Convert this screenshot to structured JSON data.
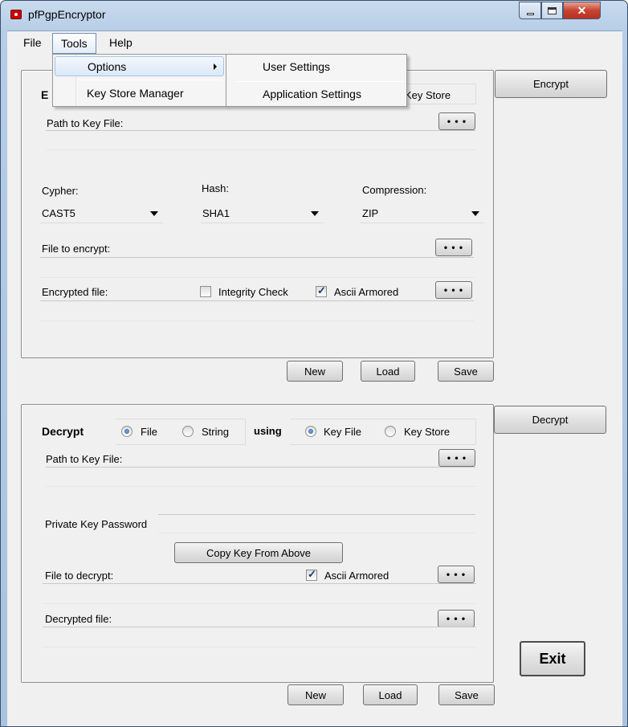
{
  "window": {
    "title": "pfPgpEncryptor"
  },
  "menu": {
    "file": "File",
    "tools": "Tools",
    "help": "Help"
  },
  "tools_menu": {
    "options": "Options",
    "key_store_manager": "Key Store Manager"
  },
  "options_submenu": {
    "user_settings": "User Settings",
    "application_settings": "Application Settings"
  },
  "encrypt": {
    "heading": "E",
    "key_store_label": "Key Store",
    "path_label": "Path to Key File:",
    "cypher_label": "Cypher:",
    "cypher_value": "CAST5",
    "hash_label": "Hash:",
    "hash_value": "SHA1",
    "compression_label": "Compression:",
    "compression_value": "ZIP",
    "file_label": "File to encrypt:",
    "output_label": "Encrypted file:",
    "integrity_label": "Integrity Check",
    "integrity_checked": false,
    "ascii_label": "Ascii Armored",
    "ascii_checked": true,
    "encrypt_button": "Encrypt",
    "new": "New",
    "load": "Load",
    "save": "Save"
  },
  "decrypt": {
    "heading": "Decrypt",
    "file_option": "File",
    "string_option": "String",
    "using": "using",
    "key_file_option": "Key File",
    "key_store_option": "Key Store",
    "path_label": "Path to Key File:",
    "password_label": "Private Key Password",
    "copy_key_button": "Copy Key From Above",
    "file_label": "File to decrypt:",
    "ascii_label": "Ascii Armored",
    "ascii_checked": true,
    "output_label": "Decrypted file:",
    "decrypt_button": "Decrypt",
    "new": "New",
    "load": "Load",
    "save": "Save"
  },
  "browse_label": "• • •",
  "exit_button": "Exit"
}
